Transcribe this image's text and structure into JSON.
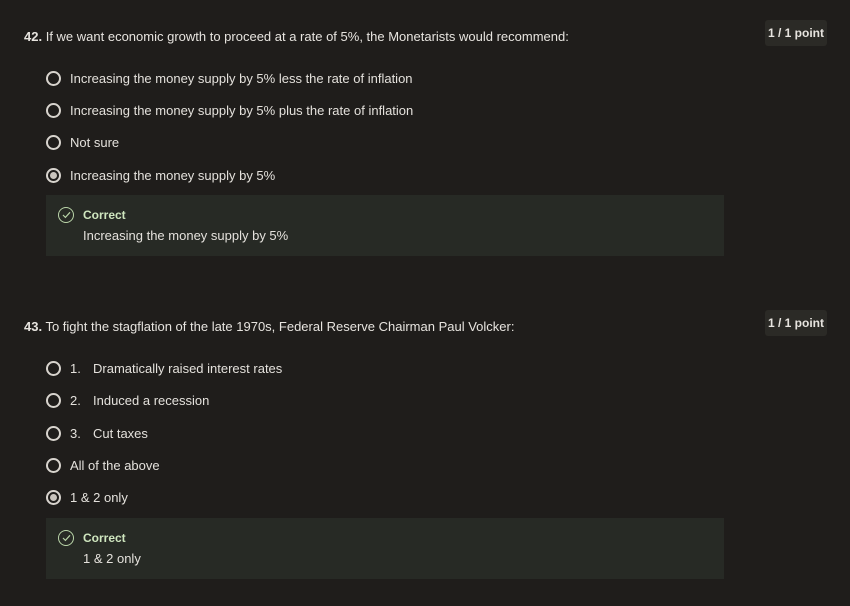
{
  "questions": [
    {
      "number": "42.",
      "text": "If we want economic growth to proceed at a rate of 5%, the Monetarists would recommend:",
      "points": "1 / 1 point",
      "options": [
        {
          "num": "",
          "label": "Increasing the money supply by 5% less the rate of inflation",
          "selected": false
        },
        {
          "num": "",
          "label": "Increasing the money supply by 5% plus the rate of inflation",
          "selected": false
        },
        {
          "num": "",
          "label": "Not sure",
          "selected": false
        },
        {
          "num": "",
          "label": "Increasing the money supply by 5%",
          "selected": true
        }
      ],
      "feedback": {
        "status": "Correct",
        "answer": "Increasing the money supply by 5%"
      }
    },
    {
      "number": "43.",
      "text": "To fight the stagflation of the late 1970s, Federal Reserve Chairman Paul Volcker:",
      "points": "1 / 1 point",
      "options": [
        {
          "num": "1.",
          "label": "Dramatically raised interest rates",
          "selected": false
        },
        {
          "num": "2.",
          "label": "Induced a recession",
          "selected": false
        },
        {
          "num": "3.",
          "label": "Cut taxes",
          "selected": false
        },
        {
          "num": "",
          "label": "All of the above",
          "selected": false
        },
        {
          "num": "",
          "label": "1 & 2 only",
          "selected": true
        }
      ],
      "feedback": {
        "status": "Correct",
        "answer": "1 & 2 only"
      }
    }
  ],
  "colors": {
    "background": "#1f1d1b",
    "feedback_bg": "#272a25",
    "correct_text": "#cfe6bf",
    "points_badge": "#2b2a26"
  },
  "icons": {
    "radio": "radio-button",
    "correct": "check-circle-icon"
  }
}
